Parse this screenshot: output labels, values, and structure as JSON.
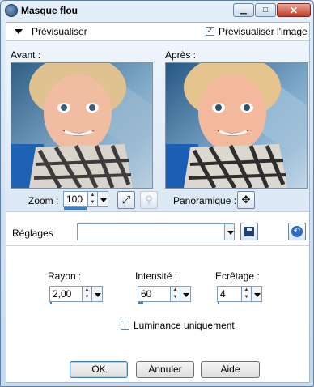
{
  "window": {
    "title": "Masque flou",
    "minimize": "▁",
    "maximize": "□",
    "close": "✕"
  },
  "preview": {
    "section_label": "Prévisualiser",
    "show_image_label": "Prévisualiser l'image",
    "show_image_checked": true,
    "before_label": "Avant :",
    "after_label": "Après :",
    "zoom_label": "Zoom :",
    "zoom_value": "100",
    "pan_label": "Panoramique :"
  },
  "settings": {
    "label": "Réglages",
    "value": ""
  },
  "params": {
    "radius_label": "Rayon :",
    "radius_value": "2,00",
    "intensity_label": "Intensité :",
    "intensity_value": "60",
    "clipping_label": "Ecrêtage :",
    "clipping_value": "4",
    "luminance_label": "Luminance uniquement",
    "luminance_checked": false
  },
  "buttons": {
    "ok": "OK",
    "cancel": "Annuler",
    "help": "Aide"
  },
  "icons": {
    "fit": "fit-window-icon",
    "zoom_tool": "magnifier-icon",
    "pan": "move-cross-icon",
    "save": "floppy-disk-icon",
    "reset": "reset-arrow-icon"
  },
  "colors": {
    "accent": "#3a7fd5",
    "title_close": "#c23c25"
  }
}
